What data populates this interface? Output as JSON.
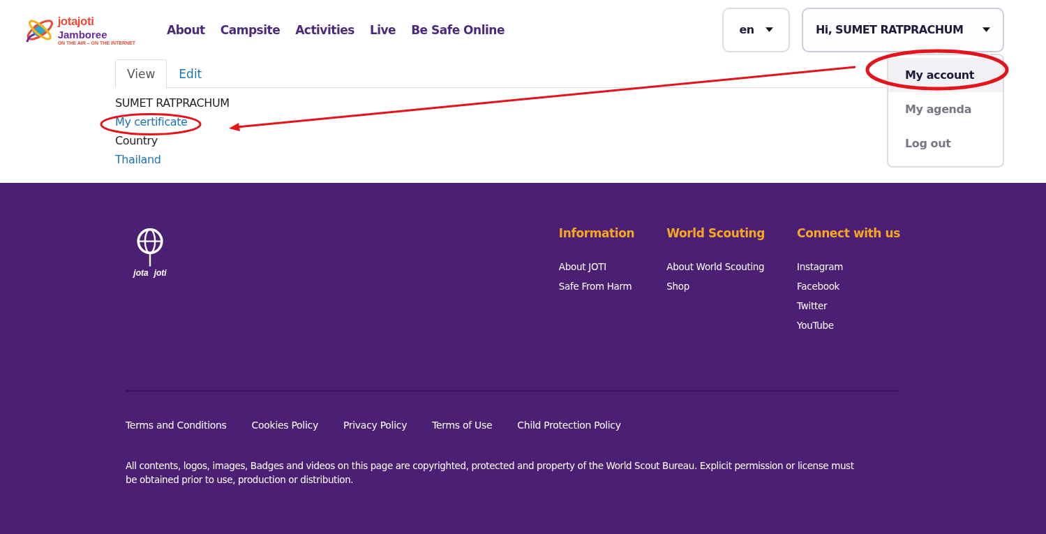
{
  "logo": {
    "line_1": "jotajoti",
    "line_2": "Jamboree",
    "tagline": "ON THE AIR – ON THE INTERNET"
  },
  "nav": [
    "About",
    "Campsite",
    "Activities",
    "Live",
    "Be Safe Online"
  ],
  "language": {
    "value": "en"
  },
  "user_menu": {
    "label": "Hi, SUMET RATPRACHUM",
    "expanded": true,
    "items": [
      {
        "label": "My account",
        "selected": true
      },
      {
        "label": "My agenda",
        "selected": false
      },
      {
        "label": "Log out",
        "selected": false
      }
    ]
  },
  "tabs": [
    {
      "label": "View",
      "selected": true
    },
    {
      "label": "Edit",
      "selected": false
    }
  ],
  "profile": [
    {
      "kind": "text",
      "text": "SUMET RATPRACHUM"
    },
    {
      "kind": "link",
      "text": "My certificate"
    },
    {
      "kind": "text",
      "text": "Country"
    },
    {
      "kind": "link",
      "text": "Thailand"
    }
  ],
  "footer": {
    "logo": {
      "left": "jota",
      "right": "joti"
    },
    "columns": [
      {
        "title": "Information",
        "links": [
          "About JOTI",
          "Safe From Harm"
        ]
      },
      {
        "title": "World Scouting",
        "links": [
          "About World Scouting",
          "Shop"
        ]
      },
      {
        "title": "Connect with us",
        "links": [
          "Instagram",
          "Facebook",
          "Twitter",
          "YouTube"
        ]
      }
    ],
    "legal_links": [
      "Terms and Conditions",
      "Cookies Policy",
      "Privacy Policy",
      "Terms of Use",
      "Child Protection Policy"
    ],
    "copyright": "All contents, logos, images, Badges and videos on this page are copyrighted, protected and property of the World Scout Bureau. Explicit permission or license must be obtained prior to use, production or distribution."
  }
}
